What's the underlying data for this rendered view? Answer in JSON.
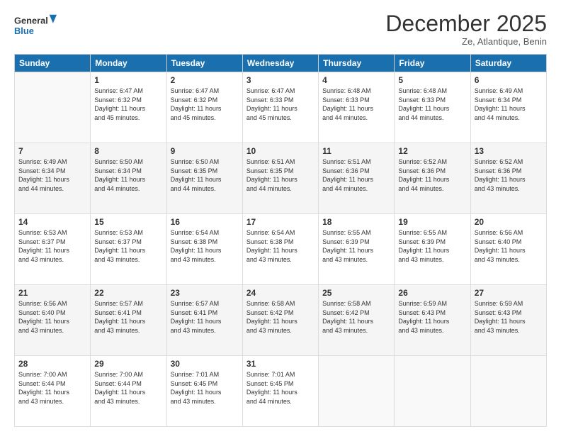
{
  "logo": {
    "line1": "General",
    "line2": "Blue"
  },
  "header": {
    "month": "December 2025",
    "location": "Ze, Atlantique, Benin"
  },
  "weekdays": [
    "Sunday",
    "Monday",
    "Tuesday",
    "Wednesday",
    "Thursday",
    "Friday",
    "Saturday"
  ],
  "weeks": [
    [
      {
        "day": "",
        "info": ""
      },
      {
        "day": "1",
        "info": "Sunrise: 6:47 AM\nSunset: 6:32 PM\nDaylight: 11 hours\nand 45 minutes."
      },
      {
        "day": "2",
        "info": "Sunrise: 6:47 AM\nSunset: 6:32 PM\nDaylight: 11 hours\nand 45 minutes."
      },
      {
        "day": "3",
        "info": "Sunrise: 6:47 AM\nSunset: 6:33 PM\nDaylight: 11 hours\nand 45 minutes."
      },
      {
        "day": "4",
        "info": "Sunrise: 6:48 AM\nSunset: 6:33 PM\nDaylight: 11 hours\nand 44 minutes."
      },
      {
        "day": "5",
        "info": "Sunrise: 6:48 AM\nSunset: 6:33 PM\nDaylight: 11 hours\nand 44 minutes."
      },
      {
        "day": "6",
        "info": "Sunrise: 6:49 AM\nSunset: 6:34 PM\nDaylight: 11 hours\nand 44 minutes."
      }
    ],
    [
      {
        "day": "7",
        "info": "Sunrise: 6:49 AM\nSunset: 6:34 PM\nDaylight: 11 hours\nand 44 minutes."
      },
      {
        "day": "8",
        "info": "Sunrise: 6:50 AM\nSunset: 6:34 PM\nDaylight: 11 hours\nand 44 minutes."
      },
      {
        "day": "9",
        "info": "Sunrise: 6:50 AM\nSunset: 6:35 PM\nDaylight: 11 hours\nand 44 minutes."
      },
      {
        "day": "10",
        "info": "Sunrise: 6:51 AM\nSunset: 6:35 PM\nDaylight: 11 hours\nand 44 minutes."
      },
      {
        "day": "11",
        "info": "Sunrise: 6:51 AM\nSunset: 6:36 PM\nDaylight: 11 hours\nand 44 minutes."
      },
      {
        "day": "12",
        "info": "Sunrise: 6:52 AM\nSunset: 6:36 PM\nDaylight: 11 hours\nand 44 minutes."
      },
      {
        "day": "13",
        "info": "Sunrise: 6:52 AM\nSunset: 6:36 PM\nDaylight: 11 hours\nand 43 minutes."
      }
    ],
    [
      {
        "day": "14",
        "info": "Sunrise: 6:53 AM\nSunset: 6:37 PM\nDaylight: 11 hours\nand 43 minutes."
      },
      {
        "day": "15",
        "info": "Sunrise: 6:53 AM\nSunset: 6:37 PM\nDaylight: 11 hours\nand 43 minutes."
      },
      {
        "day": "16",
        "info": "Sunrise: 6:54 AM\nSunset: 6:38 PM\nDaylight: 11 hours\nand 43 minutes."
      },
      {
        "day": "17",
        "info": "Sunrise: 6:54 AM\nSunset: 6:38 PM\nDaylight: 11 hours\nand 43 minutes."
      },
      {
        "day": "18",
        "info": "Sunrise: 6:55 AM\nSunset: 6:39 PM\nDaylight: 11 hours\nand 43 minutes."
      },
      {
        "day": "19",
        "info": "Sunrise: 6:55 AM\nSunset: 6:39 PM\nDaylight: 11 hours\nand 43 minutes."
      },
      {
        "day": "20",
        "info": "Sunrise: 6:56 AM\nSunset: 6:40 PM\nDaylight: 11 hours\nand 43 minutes."
      }
    ],
    [
      {
        "day": "21",
        "info": "Sunrise: 6:56 AM\nSunset: 6:40 PM\nDaylight: 11 hours\nand 43 minutes."
      },
      {
        "day": "22",
        "info": "Sunrise: 6:57 AM\nSunset: 6:41 PM\nDaylight: 11 hours\nand 43 minutes."
      },
      {
        "day": "23",
        "info": "Sunrise: 6:57 AM\nSunset: 6:41 PM\nDaylight: 11 hours\nand 43 minutes."
      },
      {
        "day": "24",
        "info": "Sunrise: 6:58 AM\nSunset: 6:42 PM\nDaylight: 11 hours\nand 43 minutes."
      },
      {
        "day": "25",
        "info": "Sunrise: 6:58 AM\nSunset: 6:42 PM\nDaylight: 11 hours\nand 43 minutes."
      },
      {
        "day": "26",
        "info": "Sunrise: 6:59 AM\nSunset: 6:43 PM\nDaylight: 11 hours\nand 43 minutes."
      },
      {
        "day": "27",
        "info": "Sunrise: 6:59 AM\nSunset: 6:43 PM\nDaylight: 11 hours\nand 43 minutes."
      }
    ],
    [
      {
        "day": "28",
        "info": "Sunrise: 7:00 AM\nSunset: 6:44 PM\nDaylight: 11 hours\nand 43 minutes."
      },
      {
        "day": "29",
        "info": "Sunrise: 7:00 AM\nSunset: 6:44 PM\nDaylight: 11 hours\nand 43 minutes."
      },
      {
        "day": "30",
        "info": "Sunrise: 7:01 AM\nSunset: 6:45 PM\nDaylight: 11 hours\nand 43 minutes."
      },
      {
        "day": "31",
        "info": "Sunrise: 7:01 AM\nSunset: 6:45 PM\nDaylight: 11 hours\nand 44 minutes."
      },
      {
        "day": "",
        "info": ""
      },
      {
        "day": "",
        "info": ""
      },
      {
        "day": "",
        "info": ""
      }
    ]
  ]
}
